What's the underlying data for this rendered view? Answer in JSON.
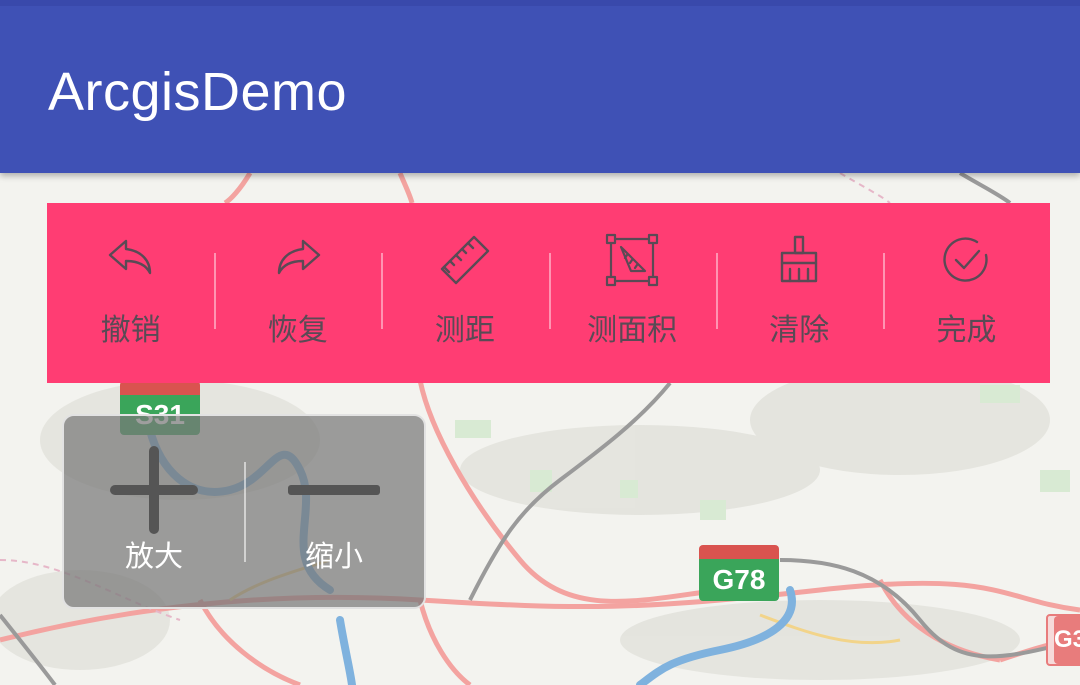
{
  "app": {
    "title": "ArcgisDemo"
  },
  "toolbar": {
    "items": [
      {
        "icon": "undo-icon",
        "label": "撤销"
      },
      {
        "icon": "redo-icon",
        "label": "恢复"
      },
      {
        "icon": "ruler-icon",
        "label": "测距"
      },
      {
        "icon": "area-measure-icon",
        "label": "测面积"
      },
      {
        "icon": "broom-icon",
        "label": "清除"
      },
      {
        "icon": "check-circle-icon",
        "label": "完成"
      }
    ]
  },
  "zoom": {
    "zoom_in": {
      "icon": "plus-icon",
      "label": "放大"
    },
    "zoom_out": {
      "icon": "minus-icon",
      "label": "缩小"
    }
  },
  "map": {
    "shields": [
      {
        "code": "S31"
      },
      {
        "code": "G78"
      },
      {
        "code": "G3"
      }
    ]
  },
  "colors": {
    "app_bar": "#3f51b5",
    "toolbar": "#ff3d73",
    "toolbar_text": "#5a4a55",
    "river": "#5b9bd5",
    "road": "#f08080"
  }
}
